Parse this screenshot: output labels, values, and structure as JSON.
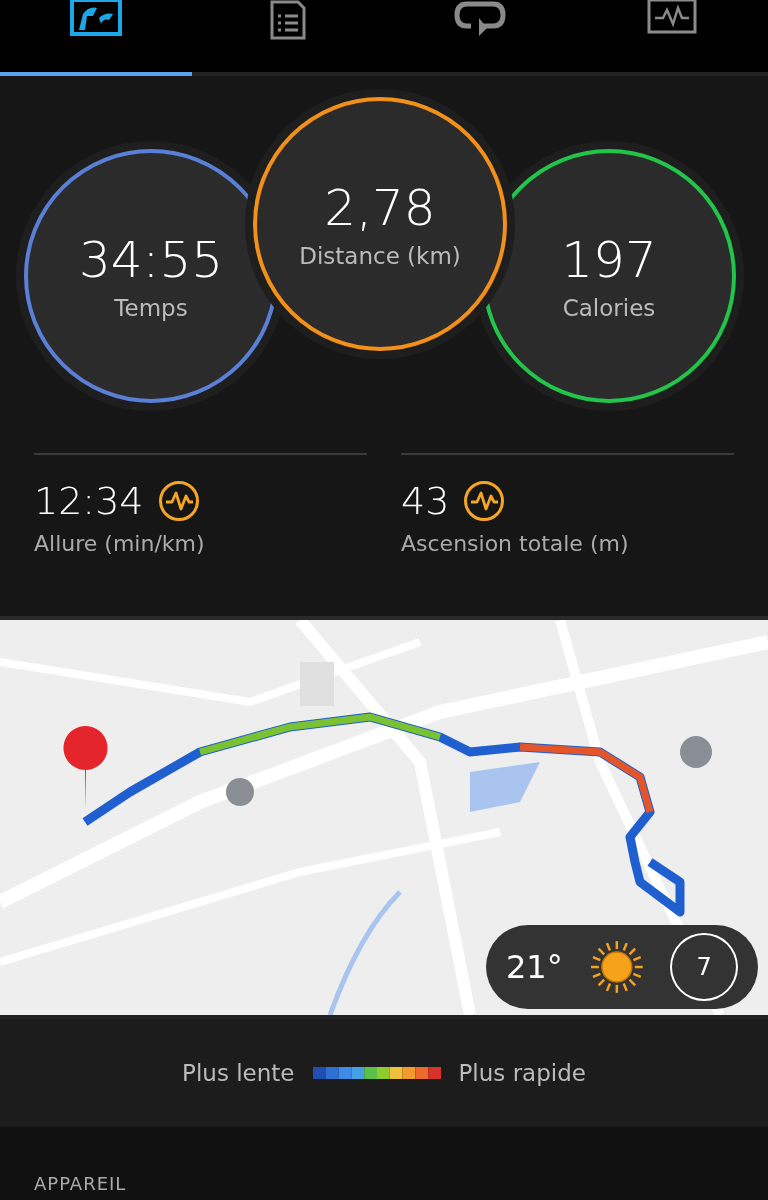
{
  "tabs": [
    {
      "kind": "summary",
      "selected": true
    },
    {
      "kind": "details",
      "selected": false
    },
    {
      "kind": "laps",
      "selected": false
    },
    {
      "kind": "charts",
      "selected": false
    }
  ],
  "rings": [
    {
      "value": "34:55",
      "label": "Temps",
      "color": "#5a7fd6"
    },
    {
      "value": "2,78",
      "label": "Distance (km)",
      "color": "#f39019"
    },
    {
      "value": "197",
      "label": "Calories",
      "color": "#22c44a"
    }
  ],
  "metrics": [
    {
      "value": "12:34",
      "label": "Allure (min/km)"
    },
    {
      "value": "43",
      "label": "Ascension totale (m)"
    }
  ],
  "map": {
    "kind": "picture",
    "weather": {
      "temperature": "21°",
      "wind_speed": "7"
    }
  },
  "legend": {
    "slow": "Plus lente",
    "fast": "Plus rapide"
  },
  "section_heading": "APPAREIL"
}
